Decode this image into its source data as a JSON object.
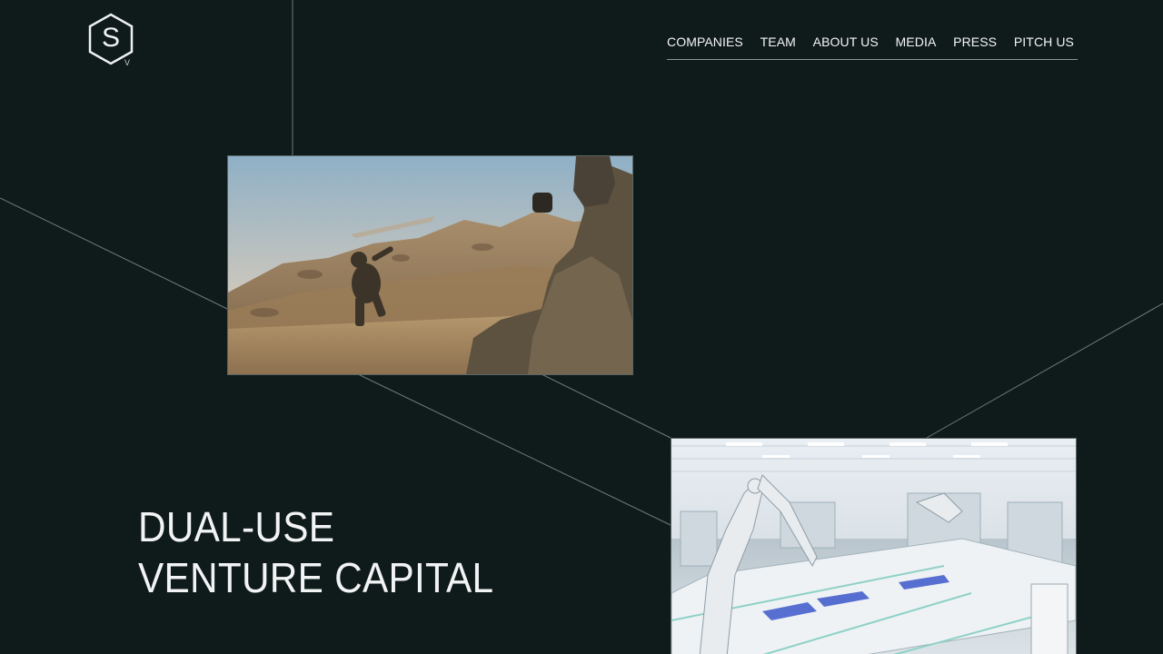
{
  "brand": {
    "logo_letter": "S",
    "logo_sub": "V"
  },
  "nav": {
    "items": [
      {
        "label": "COMPANIES"
      },
      {
        "label": "TEAM"
      },
      {
        "label": "ABOUT US"
      },
      {
        "label": "MEDIA"
      },
      {
        "label": "PRESS"
      },
      {
        "label": "PITCH US"
      }
    ]
  },
  "hero": {
    "line1": "DUAL-USE",
    "line2": "VENTURE CAPITAL"
  },
  "colors": {
    "background": "#0f1a1b",
    "text": "#f2f4f4",
    "line": "#6d7a7a"
  },
  "media": {
    "first": "soldiers-launching-drone-photo",
    "second": "robotic-factory-floor-photo"
  }
}
